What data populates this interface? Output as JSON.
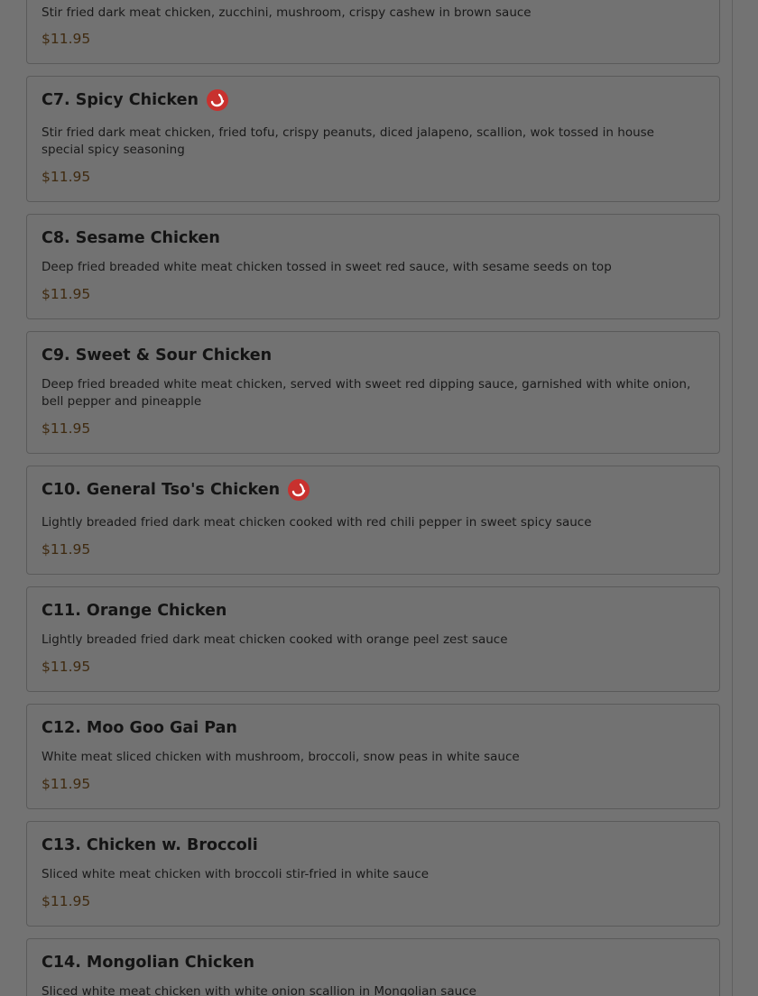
{
  "menu": {
    "items": [
      {
        "code_name": "",
        "description": "Stir fried dark meat chicken, zucchini, mushroom, crispy cashew in brown sauce",
        "price": "$11.95",
        "spicy": false
      },
      {
        "code_name": "C7. Spicy Chicken",
        "description": "Stir fried dark meat chicken, fried tofu, crispy peanuts, diced jalapeno, scallion, wok tossed in house special spicy seasoning",
        "price": "$11.95",
        "spicy": true
      },
      {
        "code_name": "C8. Sesame Chicken",
        "description": "Deep fried breaded white meat chicken tossed in sweet red sauce, with sesame seeds on top",
        "price": "$11.95",
        "spicy": false
      },
      {
        "code_name": "C9. Sweet & Sour Chicken",
        "description": "Deep fried breaded white meat chicken, served with sweet red dipping sauce, garnished with white onion, bell pepper and pineapple",
        "price": "$11.95",
        "spicy": false
      },
      {
        "code_name": "C10. General Tso's Chicken",
        "description": "Lightly breaded fried dark meat chicken cooked with red chili pepper in sweet spicy sauce",
        "price": "$11.95",
        "spicy": true
      },
      {
        "code_name": "C11. Orange Chicken",
        "description": "Lightly breaded fried dark meat chicken cooked with orange peel zest sauce",
        "price": "$11.95",
        "spicy": false
      },
      {
        "code_name": "C12. Moo Goo Gai Pan",
        "description": "White meat sliced chicken with mushroom, broccoli, snow peas in white sauce",
        "price": "$11.95",
        "spicy": false
      },
      {
        "code_name": "C13. Chicken w. Broccoli",
        "description": "Sliced white meat chicken with broccoli stir-fried in white sauce",
        "price": "$11.95",
        "spicy": false
      },
      {
        "code_name": "C14. Mongolian Chicken",
        "description": "Sliced white meat chicken with white onion scallion in Mongolian sauce",
        "price": "",
        "spicy": false
      }
    ]
  },
  "icons": {
    "spicy": "chili-pepper-icon"
  },
  "colors": {
    "spicy_badge": "#c8312e",
    "price": "#3f2a10",
    "overlay_background": "#737373"
  }
}
